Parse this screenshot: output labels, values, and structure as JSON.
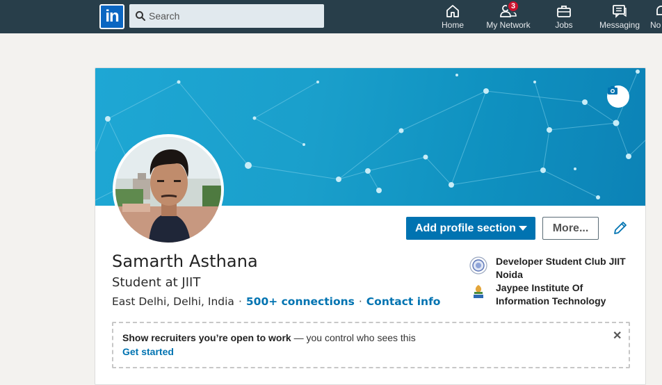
{
  "nav": {
    "logo_text": "in",
    "search_placeholder": "Search",
    "items": [
      {
        "label": "Home",
        "icon": "home-icon"
      },
      {
        "label": "My Network",
        "icon": "people-icon",
        "badge": "3"
      },
      {
        "label": "Jobs",
        "icon": "briefcase-icon"
      },
      {
        "label": "Messaging",
        "icon": "chat-icon"
      },
      {
        "label": "No",
        "icon": "bell-icon"
      }
    ]
  },
  "profile": {
    "name": "Samarth Asthana",
    "headline": "Student at JIIT",
    "location": "East Delhi, Delhi, India",
    "connections": "500+ connections",
    "contact": "Contact info",
    "separator": "·",
    "add_section_label": "Add profile section",
    "more_label": "More...",
    "organizations": [
      {
        "name": "Developer Student Club JIIT Noida",
        "icon": "dsc-logo-icon"
      },
      {
        "name": "Jaypee Institute Of Information Technology",
        "icon": "jiit-logo-icon"
      }
    ]
  },
  "recruiter": {
    "bold_text": "Show recruiters you’re open to work",
    "rest_text": " — you control who sees this",
    "cta": "Get started",
    "close": "✕"
  },
  "colors": {
    "nav_bg": "#283e4a",
    "accent": "#0073b1",
    "banner": "#1a9fcb",
    "badge": "#cb112d"
  }
}
